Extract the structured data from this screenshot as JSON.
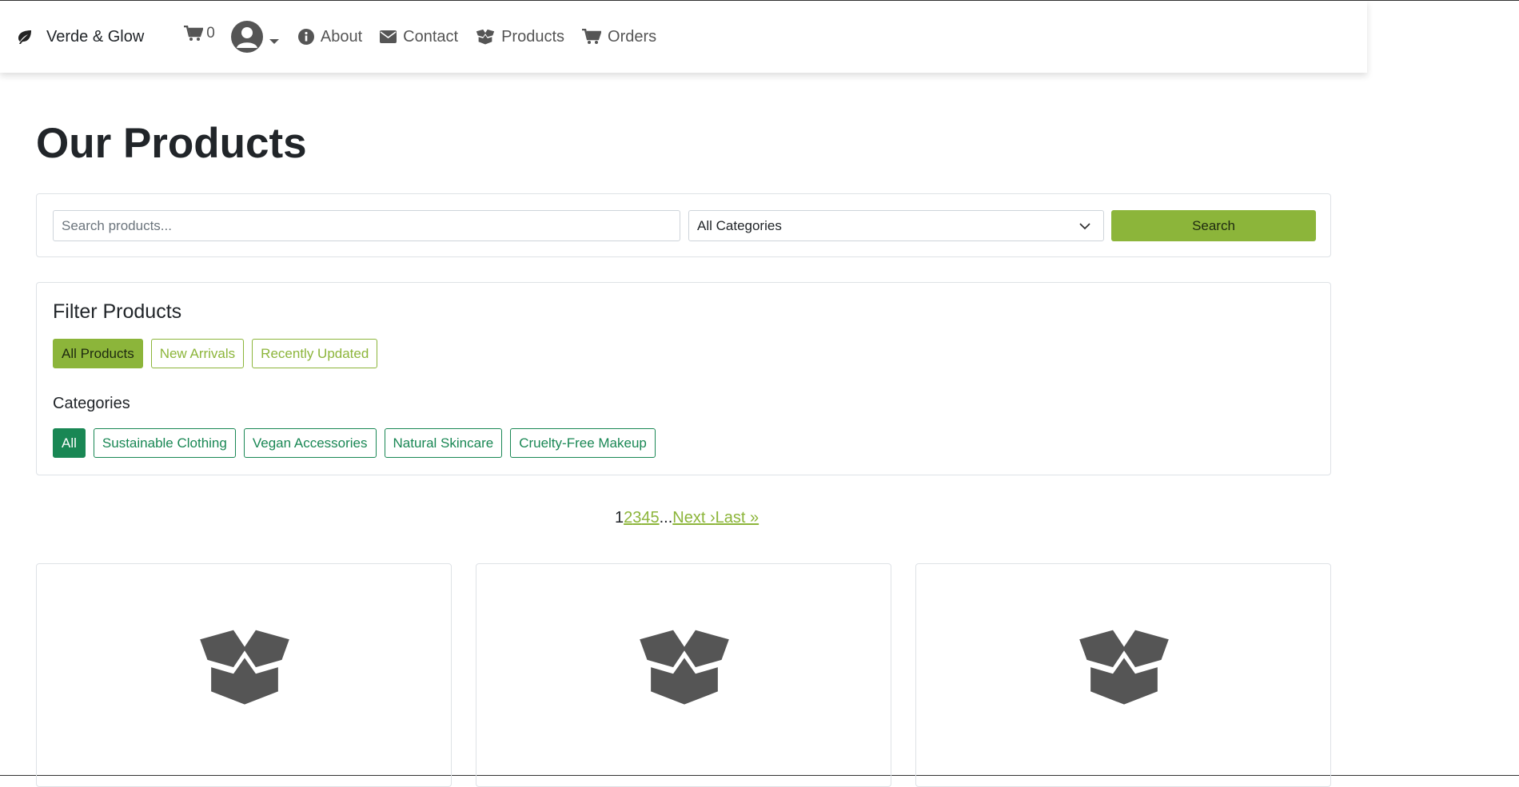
{
  "nav": {
    "brand": "Verde & Glow",
    "cart_count": "0",
    "links": [
      {
        "label": "About",
        "icon": "info-icon"
      },
      {
        "label": "Contact",
        "icon": "envelope-icon"
      },
      {
        "label": "Products",
        "icon": "box-open-icon"
      },
      {
        "label": "Orders",
        "icon": "cart-icon"
      }
    ]
  },
  "page": {
    "title": "Our Products"
  },
  "search": {
    "placeholder": "Search products...",
    "category_selected": "All Categories",
    "button_label": "Search"
  },
  "filters": {
    "title": "Filter Products",
    "options": [
      {
        "label": "All Products",
        "active": true
      },
      {
        "label": "New Arrivals",
        "active": false
      },
      {
        "label": "Recently Updated",
        "active": false
      }
    ],
    "categories_title": "Categories",
    "categories": [
      {
        "label": "All",
        "active": true
      },
      {
        "label": "Sustainable Clothing",
        "active": false
      },
      {
        "label": "Vegan Accessories",
        "active": false
      },
      {
        "label": "Natural Skincare",
        "active": false
      },
      {
        "label": "Cruelty-Free Makeup",
        "active": false
      }
    ]
  },
  "pagination": {
    "current": "1",
    "pages": [
      "2",
      "3",
      "4",
      "5"
    ],
    "ellipsis": "...",
    "next": "Next ›",
    "last": "Last »"
  },
  "colors": {
    "accent": "#8cb53a",
    "category_accent": "#198754",
    "icon_gray": "#555555"
  },
  "products": [
    {
      "icon": "box-open-icon"
    },
    {
      "icon": "box-open-icon"
    },
    {
      "icon": "box-open-icon"
    }
  ]
}
